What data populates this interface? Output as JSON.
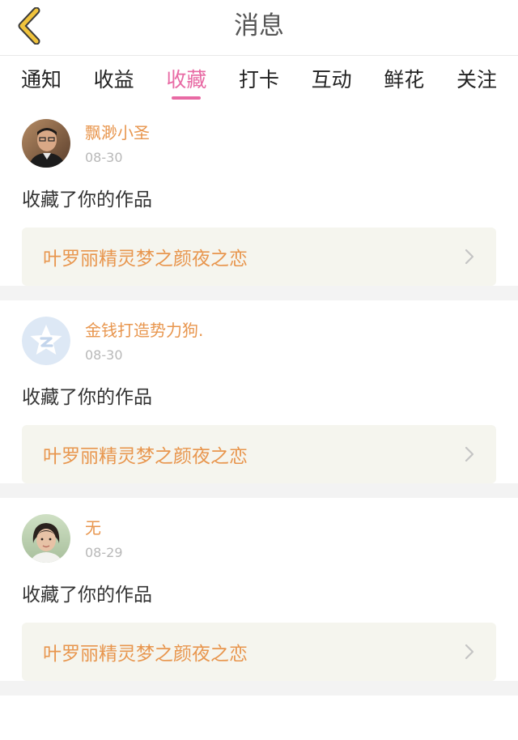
{
  "header": {
    "title": "消息"
  },
  "tabs": [
    {
      "label": "通知"
    },
    {
      "label": "收益"
    },
    {
      "label": "收藏",
      "active": true
    },
    {
      "label": "打卡"
    },
    {
      "label": "互动"
    },
    {
      "label": "鲜花"
    },
    {
      "label": "关注"
    }
  ],
  "colors": {
    "accent_pink": "#e86aa4",
    "username_orange": "#e8964e",
    "back_icon_yellow": "#f0c33c"
  },
  "items": [
    {
      "username": "飘渺小圣",
      "date": "08-30",
      "message": "收藏了你的作品",
      "work_title": "叶罗丽精灵梦之颜夜之恋",
      "avatar_icon": "photo-avatar-man"
    },
    {
      "username": "金钱打造势力狗.",
      "date": "08-30",
      "message": "收藏了你的作品",
      "work_title": "叶罗丽精灵梦之颜夜之恋",
      "avatar_icon": "qq-star-default-avatar"
    },
    {
      "username": "无",
      "date": "08-29",
      "message": "收藏了你的作品",
      "work_title": "叶罗丽精灵梦之颜夜之恋",
      "avatar_icon": "photo-avatar-woman"
    }
  ]
}
